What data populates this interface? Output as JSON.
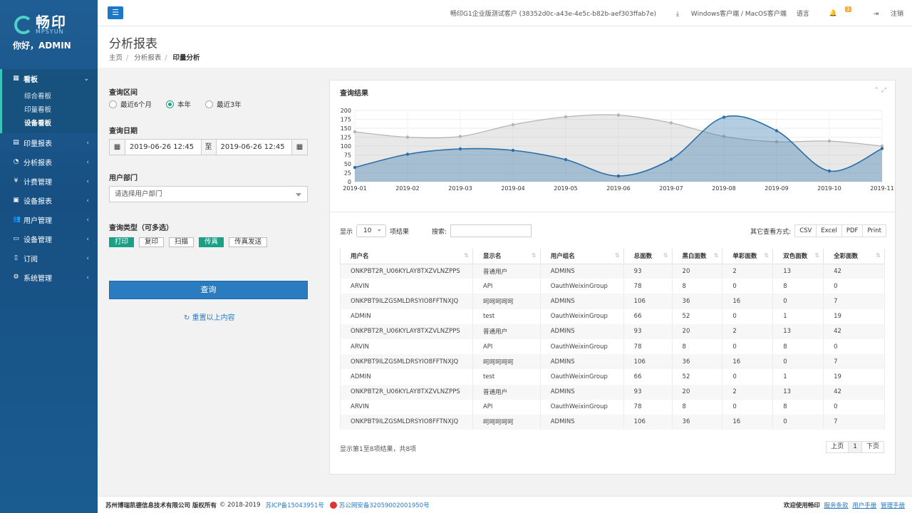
{
  "brand": {
    "name_cn": "畅印",
    "name_en": "MPSYUN",
    "greeting": "你好，ADMIN"
  },
  "sidebar": {
    "items": [
      {
        "label": "看板",
        "icon": "grid-icon",
        "active": true,
        "children": [
          {
            "label": "综合看板"
          },
          {
            "label": "印量看板"
          },
          {
            "label": "设备看板",
            "current": true
          }
        ]
      },
      {
        "label": "印量报表",
        "icon": "printer-icon"
      },
      {
        "label": "分析报表",
        "icon": "pie-chart-icon"
      },
      {
        "label": "计费管理",
        "icon": "money-icon"
      },
      {
        "label": "设备报表",
        "icon": "device-icon"
      },
      {
        "label": "用户管理",
        "icon": "users-icon"
      },
      {
        "label": "设备管理",
        "icon": "monitor-icon"
      },
      {
        "label": "订阅",
        "icon": "subscribe-icon"
      },
      {
        "label": "系统管理",
        "icon": "gears-icon"
      }
    ]
  },
  "topbar": {
    "client": "畅印G1企业版测试客户 (38352d0c-a43e-4e5c-b82b-aef303ffab7e)",
    "download": "Windows客户端 / MacOS客户端",
    "language": "语言",
    "notif_count": "3",
    "logout": "注销"
  },
  "page": {
    "title": "分析报表",
    "breadcrumb": [
      "主页",
      "分析报表",
      "印量分析"
    ]
  },
  "filters": {
    "range_label": "查询区间",
    "range_options": [
      "最近6个月",
      "本年",
      "最近3年"
    ],
    "range_selected": "本年",
    "date_label": "查询日期",
    "date_from": "2019-06-26 12:45",
    "date_sep": "至",
    "date_to": "2019-06-26 12:45",
    "dept_label": "用户部门",
    "dept_placeholder": "请选择用户部门",
    "type_label": "查询类型（可多选）",
    "types": [
      {
        "label": "打印",
        "on": true
      },
      {
        "label": "复印",
        "on": false
      },
      {
        "label": "扫描",
        "on": false
      },
      {
        "label": "传真",
        "on": true
      },
      {
        "label": "传真发送",
        "on": false
      }
    ],
    "submit": "查询",
    "reset": "重置以上内容"
  },
  "results": {
    "title": "查询结果",
    "show_prefix": "显示",
    "page_len": "10",
    "show_suffix": "项结果",
    "search_label": "搜索:",
    "export_label": "其它查看方式:",
    "exports": [
      "CSV",
      "Excel",
      "PDF",
      "Print"
    ],
    "columns": [
      "用户名",
      "显示名",
      "用户组名",
      "总面数",
      "黑白面数",
      "单彩面数",
      "双色面数",
      "全彩面数"
    ],
    "rows": [
      [
        "ONKPBT2R_U06KYLAY8TXZVLNZPPS",
        "普通用户",
        "ADMINS",
        "93",
        "20",
        "2",
        "13",
        "42"
      ],
      [
        "ARVIN",
        "API",
        "OauthWeixinGroup",
        "78",
        "8",
        "0",
        "8",
        "0"
      ],
      [
        "ONKPBT9ILZGSMLDRSYIO8FFTNXJQ",
        "呵呵呵呵呵",
        "ADMINS",
        "106",
        "36",
        "16",
        "0",
        "7"
      ],
      [
        "ADMIN",
        "test",
        "OauthWeixinGroup",
        "66",
        "52",
        "0",
        "1",
        "19"
      ],
      [
        "ONKPBT2R_U06KYLAY8TXZVLNZPPS",
        "普通用户",
        "ADMINS",
        "93",
        "20",
        "2",
        "13",
        "42"
      ],
      [
        "ARVIN",
        "API",
        "OauthWeixinGroup",
        "78",
        "8",
        "0",
        "8",
        "0"
      ],
      [
        "ONKPBT9ILZGSMLDRSYIO8FFTNXJQ",
        "呵呵呵呵呵",
        "ADMINS",
        "106",
        "36",
        "16",
        "0",
        "7"
      ],
      [
        "ADMIN",
        "test",
        "OauthWeixinGroup",
        "66",
        "52",
        "0",
        "1",
        "19"
      ],
      [
        "ONKPBT2R_U06KYLAY8TXZVLNZPPS",
        "普通用户",
        "ADMINS",
        "93",
        "20",
        "2",
        "13",
        "42"
      ],
      [
        "ARVIN",
        "API",
        "OauthWeixinGroup",
        "78",
        "8",
        "0",
        "8",
        "0"
      ],
      [
        "ONKPBT9ILZGSMLDRSYIO8FFTNXJQ",
        "呵呵呵呵呵",
        "ADMINS",
        "106",
        "36",
        "16",
        "0",
        "7"
      ]
    ],
    "info": "显示第1至8项结果，共8项",
    "pager": [
      "上页",
      "1",
      "下页"
    ]
  },
  "chart_data": {
    "type": "area",
    "x": [
      "2019-01",
      "2019-02",
      "2019-03",
      "2019-04",
      "2019-05",
      "2019-06",
      "2019-07",
      "2019-08",
      "2019-09",
      "2019-10",
      "2019-11"
    ],
    "ylim": [
      0,
      200
    ],
    "yticks": [
      0,
      25,
      50,
      75,
      100,
      125,
      150,
      175,
      200
    ],
    "series": [
      {
        "values": [
          140,
          125,
          127,
          160,
          182,
          187,
          165,
          127,
          112,
          114,
          100
        ],
        "color": "#b3b3b3"
      },
      {
        "values": [
          40,
          77,
          92,
          88,
          62,
          16,
          63,
          181,
          143,
          30,
          93
        ],
        "color": "#2a6fa8"
      }
    ],
    "grid": true
  },
  "footer": {
    "company": "苏州博瑞凯德信息技术有限公司 版权所有",
    "copyright": "© 2018-2019",
    "icp": "苏ICP备15043951号",
    "police": "苏公网安备32059002001950号",
    "welcome": "欢迎使用畅印",
    "links": [
      "服务条款",
      "用户手册",
      "管理手册"
    ]
  },
  "colors": {
    "accent": "#1aa085",
    "primary": "#2b7bc0",
    "sidebar": "#1f5e94"
  }
}
